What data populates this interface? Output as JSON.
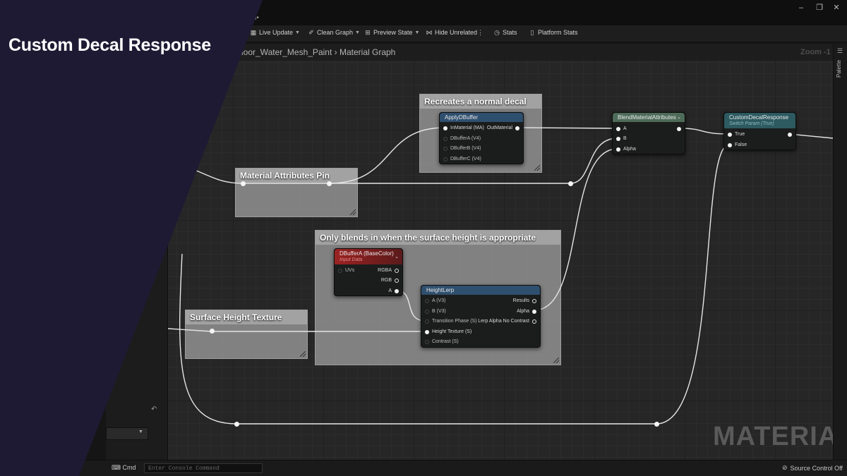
{
  "title": "Custom Decal Response",
  "window": {
    "tab_label": "ecal•",
    "controls": [
      "–",
      "❐",
      "✕"
    ]
  },
  "toolbar": [
    {
      "label": "Live Update",
      "icon": "live-update-icon",
      "chevron": true
    },
    {
      "label": "Clean Graph",
      "icon": "clean-graph-icon",
      "chevron": true
    },
    {
      "label": "Preview State",
      "icon": "preview-state-icon",
      "chevron": true
    },
    {
      "label": "Hide Unrelated",
      "icon": "hide-unrelated-icon",
      "chevron": false
    },
    {
      "label": "Stats",
      "icon": "stats-icon",
      "chevron": false
    },
    {
      "label": "Platform Stats",
      "icon": "platform-stats-icon",
      "chevron": false
    }
  ],
  "breadcrumb": {
    "asset": "loor_Water_Mesh_Paint",
    "separator": "›",
    "graph": "Material Graph"
  },
  "zoom_label": "Zoom -1",
  "palette_label": "Palette",
  "watermark": "MATERIAL",
  "comments": {
    "normal_decal": "Recreates a normal decal",
    "attributes_pin": "Material Attributes Pin",
    "height_blend": "Only blends in when the surface height is appropriate",
    "height_texture": "Surface Height Texture"
  },
  "nodes": {
    "apply_dbuffer": {
      "title": "ApplyDBuffer",
      "inputs": [
        "InMaterial (MA)",
        "DBufferA (V4)",
        "DBufferB (V4)",
        "DBufferC (V4)"
      ],
      "output": "OutMaterial"
    },
    "blend_attributes": {
      "title": "BlendMaterialAttributes",
      "inputs": [
        "A",
        "B",
        "Alpha"
      ]
    },
    "custom_decal_response": {
      "title": "CustomDecalResponse",
      "subtitle": "Switch Param (True)",
      "inputs": [
        "True",
        "False"
      ]
    },
    "dbuffer_a": {
      "title": "DBufferA (BaseColor)",
      "subtitle": "Input Data",
      "input": "UVs",
      "outputs": [
        "RGBA",
        "RGB",
        "A"
      ]
    },
    "height_lerp": {
      "title": "HeightLerp",
      "inputs": [
        "A (V3)",
        "B (V3)",
        "Transition Phase (S)",
        "Height Texture (S)",
        "Contrast (S)"
      ],
      "outputs": [
        "Results",
        "Alpha",
        "Lerp Alpha No Contrast"
      ]
    }
  },
  "bottom": {
    "cmd_label": "Cmd",
    "console_placeholder": "Enter Console Command",
    "source_control": "Source Control Off"
  },
  "colors": {
    "overlay": "#1e1a33",
    "apply_dbuffer_header": "#2f4f6e",
    "blend_header": "#4d6b58",
    "custom_decal_header": "#2c5a60",
    "dbuffer_header": "#8a1f1f",
    "height_lerp_header": "#2f4f6e"
  }
}
